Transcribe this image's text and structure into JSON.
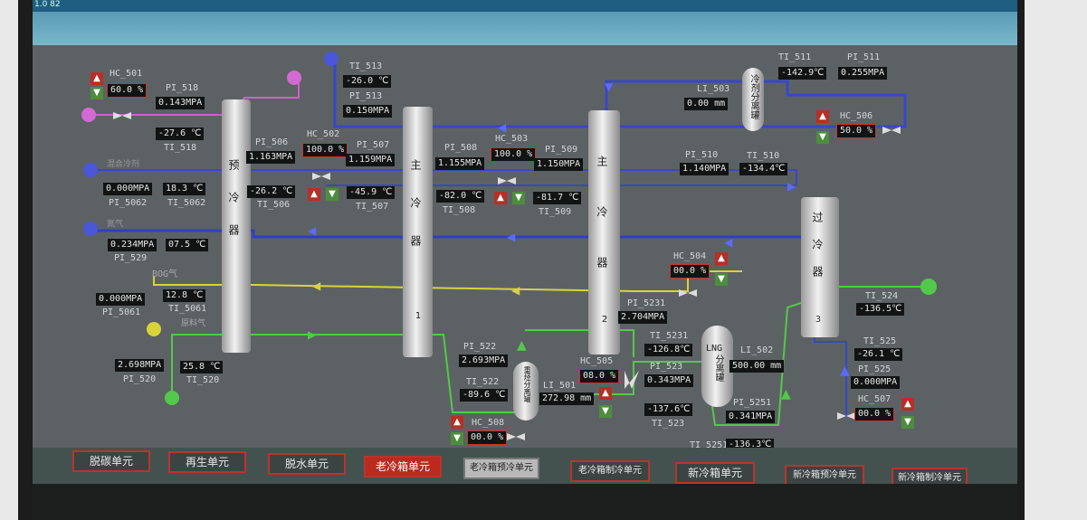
{
  "titlebar_text": "1.0 82",
  "columns": {
    "pre_cooler": "预冷器",
    "main_cooler_1": {
      "label": "主冷器",
      "num": "1"
    },
    "main_cooler_2": {
      "label": "主冷器",
      "num": "2"
    },
    "sub_cooler_3": {
      "label": "过冷器",
      "num": "3"
    },
    "refrigerant_separator": "冷剂分离罐",
    "heavy_hydrocarbon_separator": "重烃分离罐",
    "lng_separator": {
      "line1": "LNG",
      "line2": "分离罐"
    }
  },
  "streams": {
    "boil_off": "BOG气",
    "raw_gas": "原料气",
    "stream_a": "混合冷剂",
    "stream_b": "氮气"
  },
  "instruments": {
    "hc501": {
      "tag": "HC_501",
      "value": "60.0 %"
    },
    "pi518": {
      "tag": "PI_518",
      "value": "0.143MPA"
    },
    "ti518": {
      "tag": "TI_518",
      "value": "-27.6 ℃"
    },
    "pi5062": {
      "tag": "PI_5062",
      "value": "0.000MPA"
    },
    "ti5062": {
      "tag": "TI_5062",
      "value": "18.3 ℃"
    },
    "pi529": {
      "tag": "PI_529",
      "value": "0.234MPA"
    },
    "ti529": {
      "value": "07.5 ℃"
    },
    "pi5061": {
      "tag": "PI_5061",
      "value": "0.000MPA"
    },
    "ti5061": {
      "tag": "TI_5061",
      "value": "12.8 ℃"
    },
    "pi520": {
      "tag": "PI_520",
      "value": "2.698MPA"
    },
    "ti520": {
      "tag": "TI_520",
      "value": "25.8 ℃"
    },
    "pi506": {
      "tag": "PI_506",
      "value": "1.163MPA"
    },
    "ti506": {
      "tag": "TI_506",
      "value": "-26.2 ℃"
    },
    "hc502": {
      "tag": "HC_502",
      "value": "100.0 %"
    },
    "pi507": {
      "tag": "PI_507",
      "value": "1.159MPA"
    },
    "ti507": {
      "tag": "TI_507",
      "value": "-45.9 ℃"
    },
    "ti513": {
      "tag": "TI_513",
      "value": "-26.0 ℃"
    },
    "pi513": {
      "tag": "PI_513",
      "value": "0.150MPA"
    },
    "pi508": {
      "tag": "PI_508",
      "value": "1.155MPA"
    },
    "ti508": {
      "tag": "TI_508",
      "value": "-82.0 ℃"
    },
    "hc503": {
      "tag": "HC_503",
      "value": "100.0 %"
    },
    "pi509": {
      "tag": "PI_509",
      "value": "1.150MPA"
    },
    "ti509": {
      "tag": "TI_509",
      "value": "-81.7 ℃"
    },
    "li503": {
      "tag": "LI_503",
      "value": "0.00 mm"
    },
    "ti511": {
      "tag": "TI_511",
      "value": "-142.9℃"
    },
    "pi511": {
      "tag": "PI_511",
      "value": "0.255MPA"
    },
    "hc506": {
      "tag": "HC_506",
      "value": "50.0 %"
    },
    "pi510": {
      "tag": "PI_510",
      "value": "1.140MPA"
    },
    "ti510": {
      "tag": "TI_510",
      "value": "-134.4℃"
    },
    "hc504": {
      "tag": "HC_504",
      "value": "00.0 %"
    },
    "pi5231": {
      "tag": "PI_5231",
      "value": "2.704MPA"
    },
    "ti5231": {
      "tag": "TI_5231",
      "value": "-126.8℃"
    },
    "pi523": {
      "tag": "PI_523",
      "value": "0.343MPA"
    },
    "ti523": {
      "tag": "TI_523",
      "value": "-137.6℃"
    },
    "li502": {
      "tag": "LI_502",
      "value": "500.00 mm"
    },
    "pi5251": {
      "tag": "PI_5251",
      "value": "0.341MPA"
    },
    "ti5251": {
      "tag": "TI_5251",
      "value": "-136.3℃"
    },
    "ti524": {
      "tag": "TI_524",
      "value": "-136.5℃"
    },
    "ti525": {
      "tag": "TI_525",
      "value": "-26.1 ℃"
    },
    "pi525": {
      "tag": "PI_525",
      "value": "0.000MPA"
    },
    "hc507": {
      "tag": "HC_507",
      "value": "00.0 %"
    },
    "pi522": {
      "tag": "PI_522",
      "value": "2.693MPA"
    },
    "ti522": {
      "tag": "TI_522",
      "value": "-89.6 ℃"
    },
    "li501": {
      "tag": "LI_501",
      "value": "272.98 mm"
    },
    "hc505": {
      "tag": "HC_505",
      "value": "08.0 %"
    },
    "hc508": {
      "tag": "HC_508",
      "value": "00.0 %"
    }
  },
  "nav": {
    "decarb": "脱碳单元",
    "regen": "再生单元",
    "dehydrate": "脱水单元",
    "old_coldbox": "老冷箱单元",
    "old_precool": "老冷箱预冷单元",
    "old_refrig": "老冷箱制冷单元",
    "new_coldbox": "新冷箱单元",
    "new_precool": "新冷箱预冷单元",
    "new_refrig": "新冷箱制冷单元"
  },
  "colors": {
    "blue_line": "#3846c8",
    "yellow_line": "#d7d43a",
    "green_line": "#52c94a",
    "magenta_line": "#cf5fcf",
    "alarm_red": "#c8342a"
  }
}
